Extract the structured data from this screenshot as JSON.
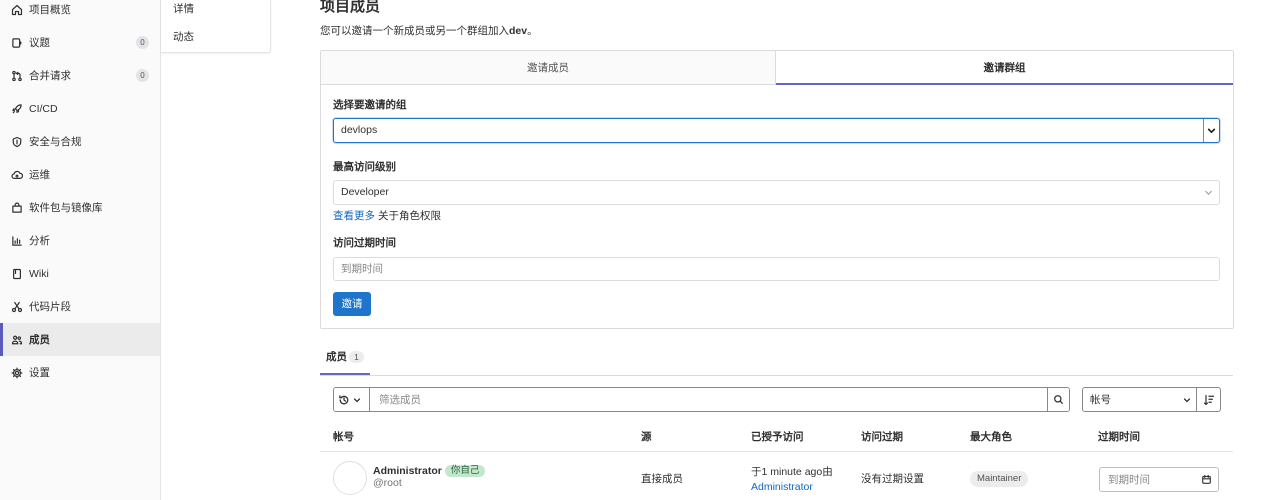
{
  "sidebar": {
    "items": [
      {
        "label": "项目概览",
        "icon": "home-icon"
      },
      {
        "label": "议题",
        "icon": "issues-icon",
        "count": "0"
      },
      {
        "label": "合并请求",
        "icon": "merge-request-icon",
        "count": "0"
      },
      {
        "label": "CI/CD",
        "icon": "rocket-icon"
      },
      {
        "label": "安全与合规",
        "icon": "shield-icon"
      },
      {
        "label": "运维",
        "icon": "cloud-icon"
      },
      {
        "label": "软件包与镜像库",
        "icon": "package-icon"
      },
      {
        "label": "分析",
        "icon": "chart-icon"
      },
      {
        "label": "Wiki",
        "icon": "book-icon"
      },
      {
        "label": "代码片段",
        "icon": "scissors-icon"
      },
      {
        "label": "成员",
        "icon": "users-icon",
        "active": true
      },
      {
        "label": "设置",
        "icon": "gear-icon"
      }
    ]
  },
  "flyout": {
    "items": [
      {
        "label": "详情"
      },
      {
        "label": "动态"
      }
    ]
  },
  "page": {
    "title": "项目成员",
    "subtitle_prefix": "您可以邀请一个新成员或另一个群组加入",
    "project_name": "dev",
    "subtitle_suffix": "。"
  },
  "invite_tabs": [
    {
      "label": "邀请成员",
      "active": false
    },
    {
      "label": "邀请群组",
      "active": true
    }
  ],
  "invite_form": {
    "group_label": "选择要邀请的组",
    "group_value": "devlops",
    "access_label": "最高访问级别",
    "access_value": "Developer",
    "permissions_link": "查看更多",
    "permissions_text": "关于角色权限",
    "expiry_label": "访问过期时间",
    "expiry_placeholder": "到期时间",
    "submit_label": "邀请"
  },
  "members_tab": {
    "label": "成员",
    "count": "1"
  },
  "filter": {
    "placeholder": "筛选成员",
    "sort_by": "帐号"
  },
  "table": {
    "columns": [
      "帐号",
      "源",
      "已授予访问",
      "访问过期",
      "最大角色",
      "过期时间"
    ],
    "rows": [
      {
        "name": "Administrator",
        "self_badge": "你自己",
        "username": "@root",
        "source": "直接成员",
        "granted_prefix": "于1 minute ago由",
        "granted_by": "Administrator",
        "access_expiry": "没有过期设置",
        "max_role": "Maintainer",
        "expiry_placeholder": "到期时间"
      }
    ]
  },
  "colors": {
    "accent": "#1f75cb",
    "link": "#1068bf",
    "active_indicator": "#6666c4",
    "success_badge_bg": "#c3e6cd",
    "success_badge_text": "#24663b"
  }
}
